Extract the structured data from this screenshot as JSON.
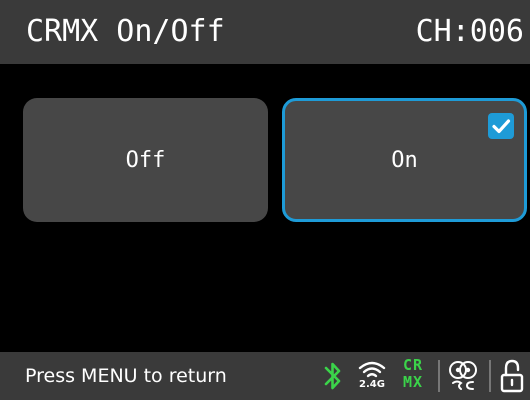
{
  "header": {
    "title": "CRMX On/Off",
    "channel": "CH:006"
  },
  "options": [
    {
      "label": "Off",
      "selected": false
    },
    {
      "label": "On",
      "selected": true
    }
  ],
  "footer": {
    "hint": "Press MENU to return",
    "status_icons": {
      "bluetooth": "bluetooth-icon",
      "wireless": "wireless-2.4g-icon",
      "wireless_label": "2.4G",
      "crmx_top": "CR",
      "crmx_bottom": "MX",
      "dmx": "dmx-link-icon",
      "lock": "unlock-icon"
    }
  },
  "colors": {
    "accent": "#1e9bd7",
    "crmx_green": "#3bd34a",
    "bar_bg": "#3a3a3a",
    "button_bg": "#474747"
  }
}
